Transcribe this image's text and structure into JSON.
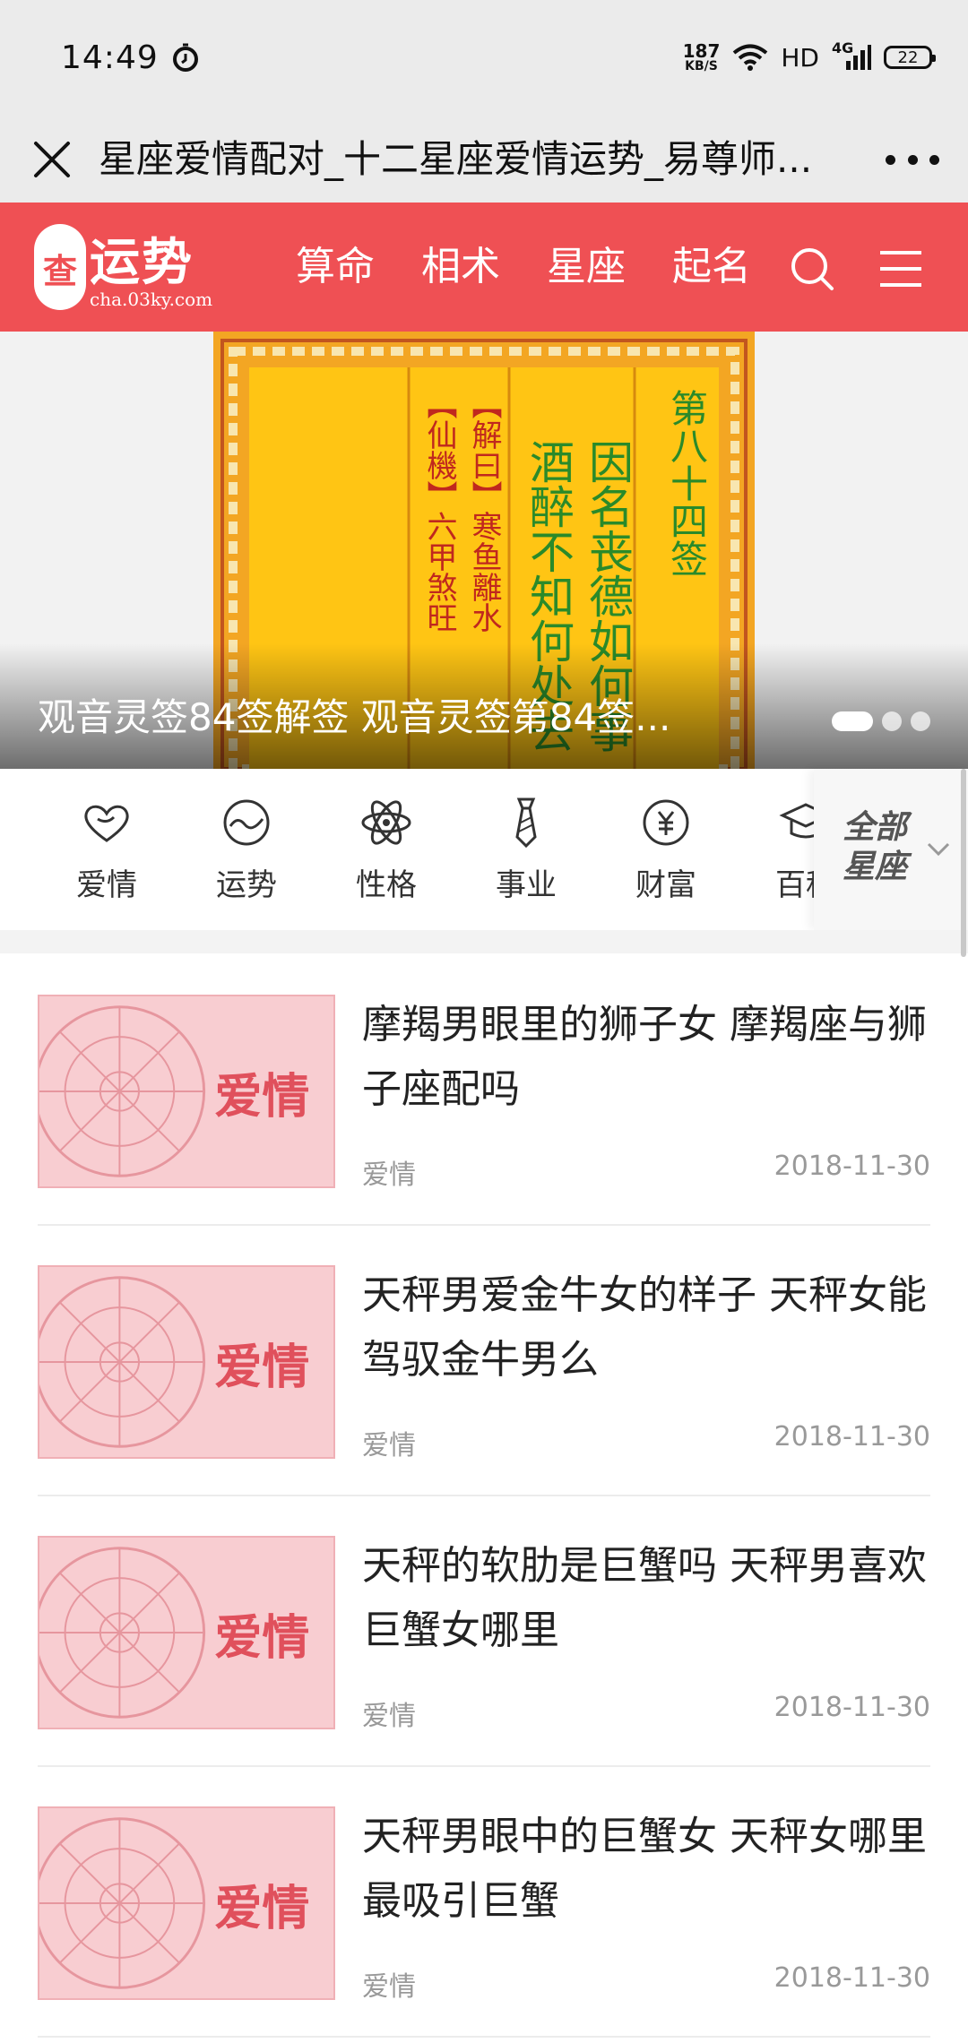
{
  "status_bar": {
    "time": "14:49",
    "speed_value": "187",
    "speed_unit": "KB/S",
    "hd": "HD",
    "network": "4G",
    "battery": "22"
  },
  "title_bar": {
    "title": "星座爱情配对_十二星座爱情运势_易尊师..."
  },
  "header": {
    "logo_text": "运势",
    "logo_url": "cha.03ky.com",
    "nav": [
      "算命",
      "相术",
      "星座",
      "起名"
    ],
    "brand_color": "#ef5054"
  },
  "banner": {
    "caption": "观音灵签84签解签 观音灵签第84签...",
    "slide_count": 3,
    "active_slide": 1,
    "image_lines": [
      "第八十四签",
      "因名丧德如何事",
      "酒醉不知何处去",
      "【解曰】寒鱼離水",
      "【仙機】六甲煞旺"
    ]
  },
  "categories": {
    "items": [
      {
        "label": "爱情",
        "icon": "heart-icon"
      },
      {
        "label": "运势",
        "icon": "trend-icon"
      },
      {
        "label": "性格",
        "icon": "atom-icon"
      },
      {
        "label": "事业",
        "icon": "tie-icon"
      },
      {
        "label": "财富",
        "icon": "yuan-coin-icon"
      },
      {
        "label": "百科",
        "icon": "graduation-cap-icon"
      }
    ],
    "all_label": "全部星座"
  },
  "articles": [
    {
      "title": "摩羯男眼里的狮子女 摩羯座与狮子座配吗",
      "tag": "爱情",
      "date": "2018-11-30",
      "thumb_label": "爱情"
    },
    {
      "title": "天秤男爱金牛女的样子 天秤女能驾驭金牛男么",
      "tag": "爱情",
      "date": "2018-11-30",
      "thumb_label": "爱情"
    },
    {
      "title": "天秤的软肋是巨蟹吗 天秤男喜欢巨蟹女哪里",
      "tag": "爱情",
      "date": "2018-11-30",
      "thumb_label": "爱情"
    },
    {
      "title": "天秤男眼中的巨蟹女 天秤女哪里最吸引巨蟹",
      "tag": "爱情",
      "date": "2018-11-30",
      "thumb_label": "爱情"
    }
  ]
}
